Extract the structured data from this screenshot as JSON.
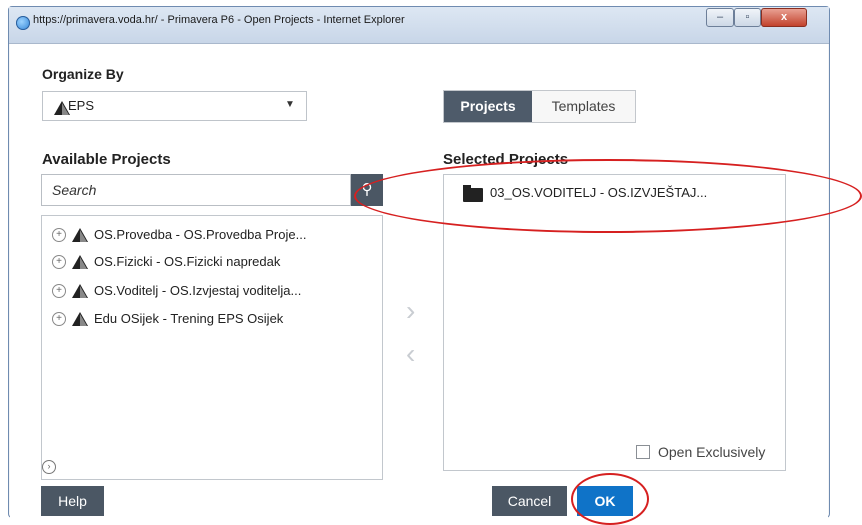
{
  "window": {
    "title": "https://primavera.voda.hr/ - Primavera P6 - Open Projects - Internet Explorer",
    "controls": {
      "minimize": "–",
      "maximize": "▫",
      "close": "x"
    }
  },
  "organize": {
    "label": "Organize By",
    "selected": "EPS"
  },
  "view_toggle": {
    "projects": "Projects",
    "templates": "Templates",
    "active": "Projects"
  },
  "available": {
    "heading": "Available Projects",
    "search_placeholder": "Search",
    "items": [
      {
        "label": "OS.Provedba - OS.Provedba Proje..."
      },
      {
        "label": "OS.Fizicki - OS.Fizicki napredak"
      },
      {
        "label": "OS.Voditelj - OS.Izvjestaj voditelja..."
      },
      {
        "label": "Edu OSijek - Trening EPS Osijek"
      }
    ]
  },
  "selected": {
    "heading": "Selected Projects",
    "items": [
      {
        "label": "03_OS.VODITELJ - OS.IZVJEŠTAJ..."
      }
    ]
  },
  "open_exclusively": {
    "label": "Open Exclusively",
    "checked": false
  },
  "buttons": {
    "help": "Help",
    "cancel": "Cancel",
    "ok": "OK"
  },
  "colors": {
    "primary_button": "#0f73c8",
    "dark_button": "#4b5764",
    "annotation": "#d62020"
  }
}
